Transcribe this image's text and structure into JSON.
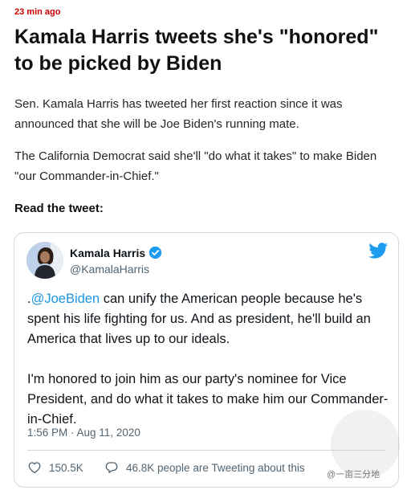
{
  "article": {
    "timestamp": "23 min ago",
    "headline": "Kamala Harris tweets she's \"honored\" to be picked by Biden",
    "paragraph1": "Sen. Kamala Harris has tweeted her first reaction since it was announced that she will be Joe Biden's running mate.",
    "paragraph2": "The California Democrat said she'll \"do what it takes\" to make Biden \"our Commander-in-Chief.\"",
    "subhead": "Read the tweet:"
  },
  "tweet": {
    "author_name": "Kamala Harris",
    "author_handle": "@KamalaHarris",
    "text_prefix": ".",
    "mention": "@JoeBiden",
    "text_line1_rest": " can unify the American people because he's spent his life fighting for us. And as president, he'll build an America that lives up to our ideals.",
    "text_paragraph2": "I'm honored to join him as our party's nominee for Vice President, and do what it takes to make him our Commander-in-Chief.",
    "timestamp": "1:56 PM · Aug 11, 2020",
    "likes": "150.5K",
    "reply_text": "46.8K people are Tweeting about this",
    "icons": {
      "verified": "verified-icon",
      "bird": "twitter-bird-icon",
      "like": "heart-icon",
      "reply": "comment-icon"
    },
    "colors": {
      "mention": "#1b95e0",
      "bird": "#1d9bf0",
      "verified": "#1d9bf0"
    }
  },
  "watermark": {
    "text": "@一亩三分地"
  },
  "colors": {
    "timestamp": "#cc0000",
    "headline": "#111111"
  }
}
